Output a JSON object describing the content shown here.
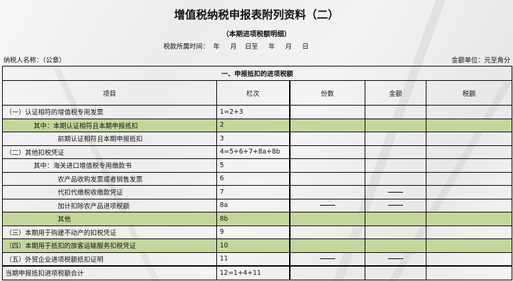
{
  "title": "增值税纳税申报表附列资料（二）",
  "subtitle": "（本期进项税额明细）",
  "period": "税款所属时间：  年     月    日至     年     月     日",
  "payer_label": "纳税人名称：（公章）",
  "unit_label": "金额单位：元至角分",
  "section_title": "一、申报抵扣的进项税额",
  "headers": [
    "项目",
    "栏次",
    "份数",
    "金额",
    "税额"
  ],
  "rows": [
    {
      "item": "（一）认证相符的增值税专用发票",
      "line": "1=2+3"
    },
    {
      "item": "其中：本期认证相符且本期申报抵扣",
      "line": "2"
    },
    {
      "item": "前期认证相符且本期申报抵扣",
      "line": "3"
    },
    {
      "item": "（二）其他扣税凭证",
      "line": "4=5+6+7+8a+8b"
    },
    {
      "item": "其中：海关进口增值税专用缴款书",
      "line": "5"
    },
    {
      "item": "农产品收购发票或者销售发票",
      "line": "6"
    },
    {
      "item": "代扣代缴税收缴款凭证",
      "line": "7"
    },
    {
      "item": "加计扣除农产品进项税额",
      "line": "8a"
    },
    {
      "item": "其他",
      "line": "8b"
    },
    {
      "item": "（三）本期用于购建不动产的扣税凭证",
      "line": "9"
    },
    {
      "item": "（四）本期用于抵扣的旅客运输服务扣税凭证",
      "line": "10"
    },
    {
      "item": "（五）外贸企业进项税额抵扣证明",
      "line": "11"
    },
    {
      "item": "当期申报抵扣进项税额合计",
      "line": "12=1+4+11"
    }
  ],
  "highlight_color": "#c4d79b"
}
